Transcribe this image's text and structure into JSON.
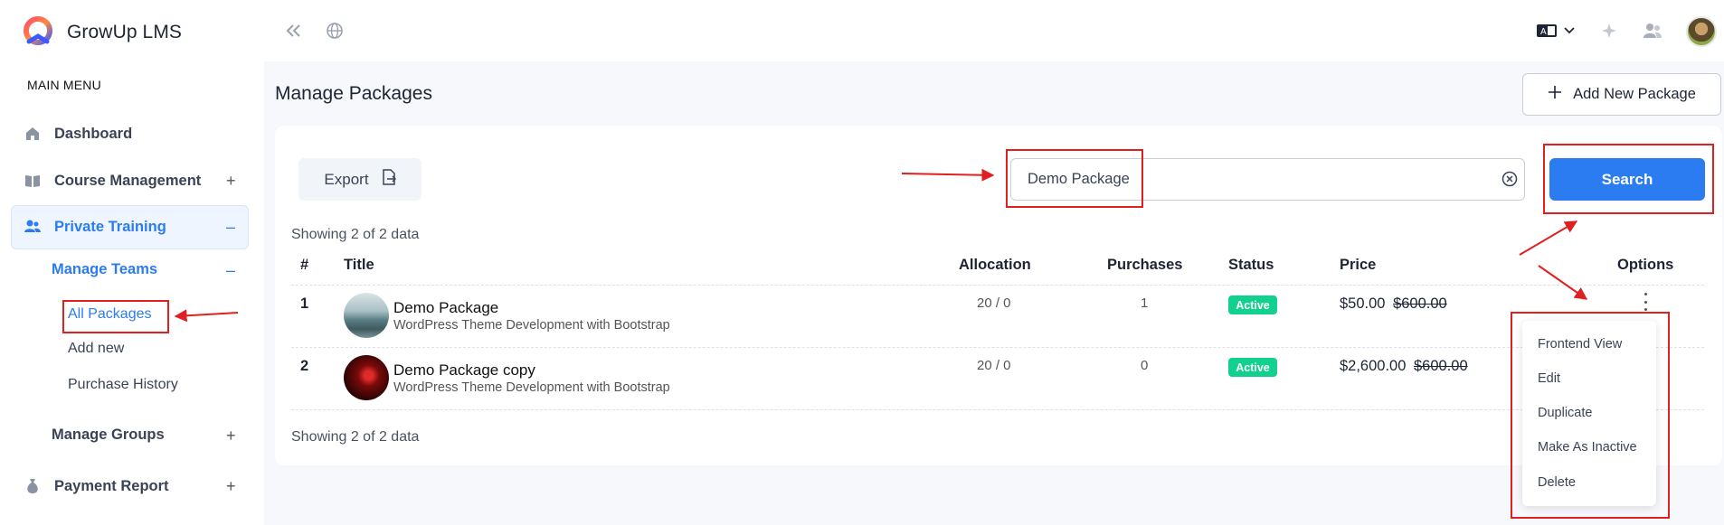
{
  "app": {
    "name": "GrowUp LMS"
  },
  "sidebar": {
    "section_label": "MAIN MENU",
    "items": [
      {
        "label": "Dashboard",
        "icon": "home-icon"
      },
      {
        "label": "Course Management",
        "icon": "book-icon",
        "toggle": "+"
      },
      {
        "label": "Private Training",
        "icon": "users-icon",
        "toggle": "–"
      },
      {
        "label": "Manage Teams",
        "toggle": "–"
      },
      {
        "label": "All Packages"
      },
      {
        "label": "Add new"
      },
      {
        "label": "Purchase History"
      },
      {
        "label": "Manage Groups",
        "toggle": "+"
      },
      {
        "label": "Payment Report",
        "icon": "money-bag-icon",
        "toggle": "+"
      }
    ]
  },
  "page": {
    "title": "Manage Packages",
    "add_button": "Add New Package",
    "export_button": "Export",
    "search": {
      "value": "Demo Package",
      "button": "Search"
    },
    "showing_top": "Showing 2 of 2 data",
    "showing_bottom": "Showing 2 of 2 data"
  },
  "table": {
    "headers": [
      "#",
      "Title",
      "Allocation",
      "Purchases",
      "Status",
      "Price",
      "Options"
    ],
    "rows": [
      {
        "num": "1",
        "title": "Demo Package",
        "subtitle": "WordPress Theme Development with Bootstrap",
        "allocation": "20 / 0",
        "purchases": "1",
        "status": "Active",
        "price": "$50.00",
        "old_price": "$600.00"
      },
      {
        "num": "2",
        "title": "Demo Package copy",
        "subtitle": "WordPress Theme Development with Bootstrap",
        "allocation": "20 / 0",
        "purchases": "0",
        "status": "Active",
        "price": "$2,600.00",
        "old_price": "$600.00"
      }
    ]
  },
  "options_menu": [
    "Frontend View",
    "Edit",
    "Duplicate",
    "Make As Inactive",
    "Delete"
  ],
  "colors": {
    "primary": "#2b7cf0",
    "active_badge": "#12d18e",
    "annotation": "#e02020"
  }
}
